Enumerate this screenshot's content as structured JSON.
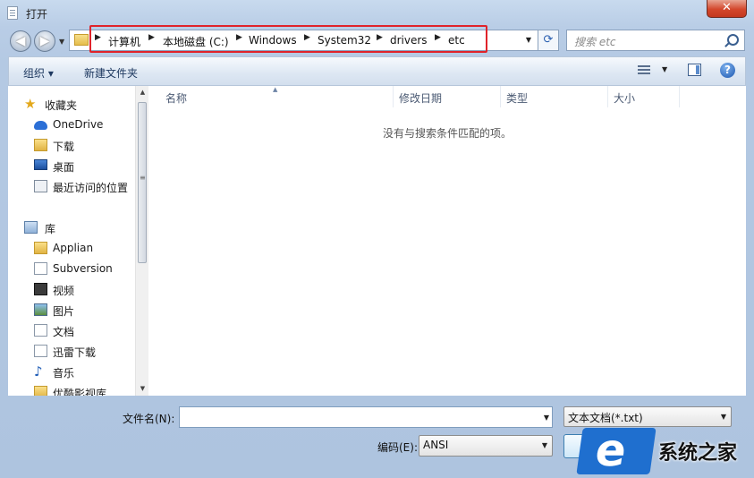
{
  "window": {
    "title": "打开",
    "close_label": "✕"
  },
  "nav": {
    "back_glyph": "◀",
    "forward_glyph": "▶",
    "breadcrumb": [
      "计算机",
      "本地磁盘 (C:)",
      "Windows",
      "System32",
      "drivers",
      "etc"
    ],
    "refresh_glyph": "⟳",
    "search_placeholder": "搜索 etc"
  },
  "toolbar": {
    "organize_label": "组织 ▾",
    "new_folder_label": "新建文件夹",
    "help_label": "?"
  },
  "sidebar": {
    "items": [
      {
        "label": "收藏夹",
        "icon": "star-icon"
      },
      {
        "label": "OneDrive",
        "icon": "cloud-icon"
      },
      {
        "label": "下载",
        "icon": "folder-icon"
      },
      {
        "label": "桌面",
        "icon": "desktop-icon"
      },
      {
        "label": "最近访问的位置",
        "icon": "recent-icon"
      },
      {
        "label": "库",
        "icon": "library-icon"
      },
      {
        "label": "Applian",
        "icon": "folder-icon"
      },
      {
        "label": "Subversion",
        "icon": "document-icon"
      },
      {
        "label": "视频",
        "icon": "video-icon"
      },
      {
        "label": "图片",
        "icon": "picture-icon"
      },
      {
        "label": "文档",
        "icon": "document-icon"
      },
      {
        "label": "迅雷下载",
        "icon": "document-icon"
      },
      {
        "label": "音乐",
        "icon": "music-icon"
      },
      {
        "label": "优酷影视库",
        "icon": "folder-icon"
      }
    ]
  },
  "filelist": {
    "columns": [
      "名称",
      "修改日期",
      "类型",
      "大小"
    ],
    "empty_message": "没有与搜索条件匹配的项。"
  },
  "bottom": {
    "filename_label": "文件名(N):",
    "filename_value": "",
    "filetype_value": "文本文档(*.txt)",
    "encoding_label": "编码(E):",
    "encoding_value": "ANSI"
  },
  "watermark": {
    "text": "系统之家"
  }
}
